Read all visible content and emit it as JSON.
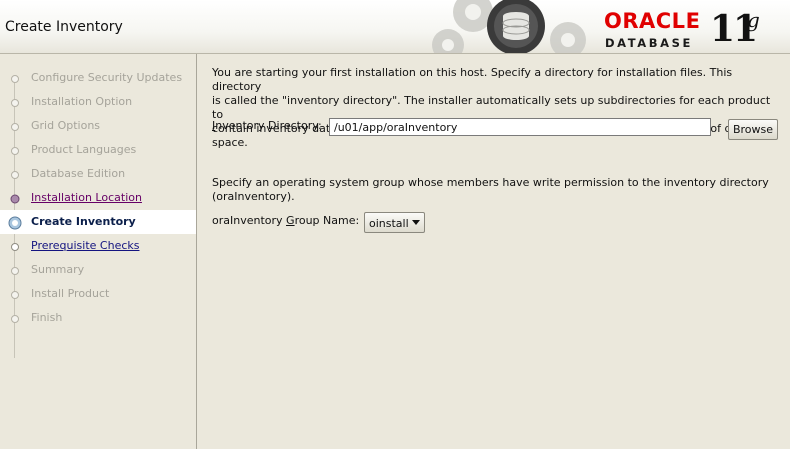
{
  "window": {
    "title": "Create Inventory"
  },
  "branding": {
    "oracle": "ORACLE",
    "database": "DATABASE",
    "version_number": "11",
    "version_suffix": "g",
    "brand_color": "#e00000"
  },
  "steps": [
    {
      "label": "Configure Security Updates",
      "state": "done"
    },
    {
      "label": "Installation Option",
      "state": "done"
    },
    {
      "label": "Grid Options",
      "state": "done"
    },
    {
      "label": "Product Languages",
      "state": "done"
    },
    {
      "label": "Database Edition",
      "state": "done"
    },
    {
      "label": "Installation Location",
      "state": "visited"
    },
    {
      "label": "Create Inventory",
      "state": "current"
    },
    {
      "label": "Prerequisite Checks",
      "state": "link"
    },
    {
      "label": "Summary",
      "state": "future"
    },
    {
      "label": "Install Product",
      "state": "future"
    },
    {
      "label": "Finish",
      "state": "future"
    }
  ],
  "main": {
    "intro_line1": "You are starting your first installation on this host. Specify a directory for installation files. This directory",
    "intro_line2": "is called the \"inventory directory\". The installer automatically sets up subdirectories for each product to",
    "intro_line3": "contain inventory data. The subdirectory for each product typically requires 150 kilobytes of disk space.",
    "inventory_label_mnemonic": "I",
    "inventory_label_rest": "nventory Directory:",
    "inventory_value": "/u01/app/oraInventory",
    "browse_label": "Browse",
    "group_line1": "Specify an operating system group whose members have write permission to the inventory directory",
    "group_line2": "(oraInventory).",
    "group_label_pre": "oraInventory ",
    "group_label_mnemonic": "G",
    "group_label_post": "roup Name:",
    "group_selected": "oinstall"
  }
}
